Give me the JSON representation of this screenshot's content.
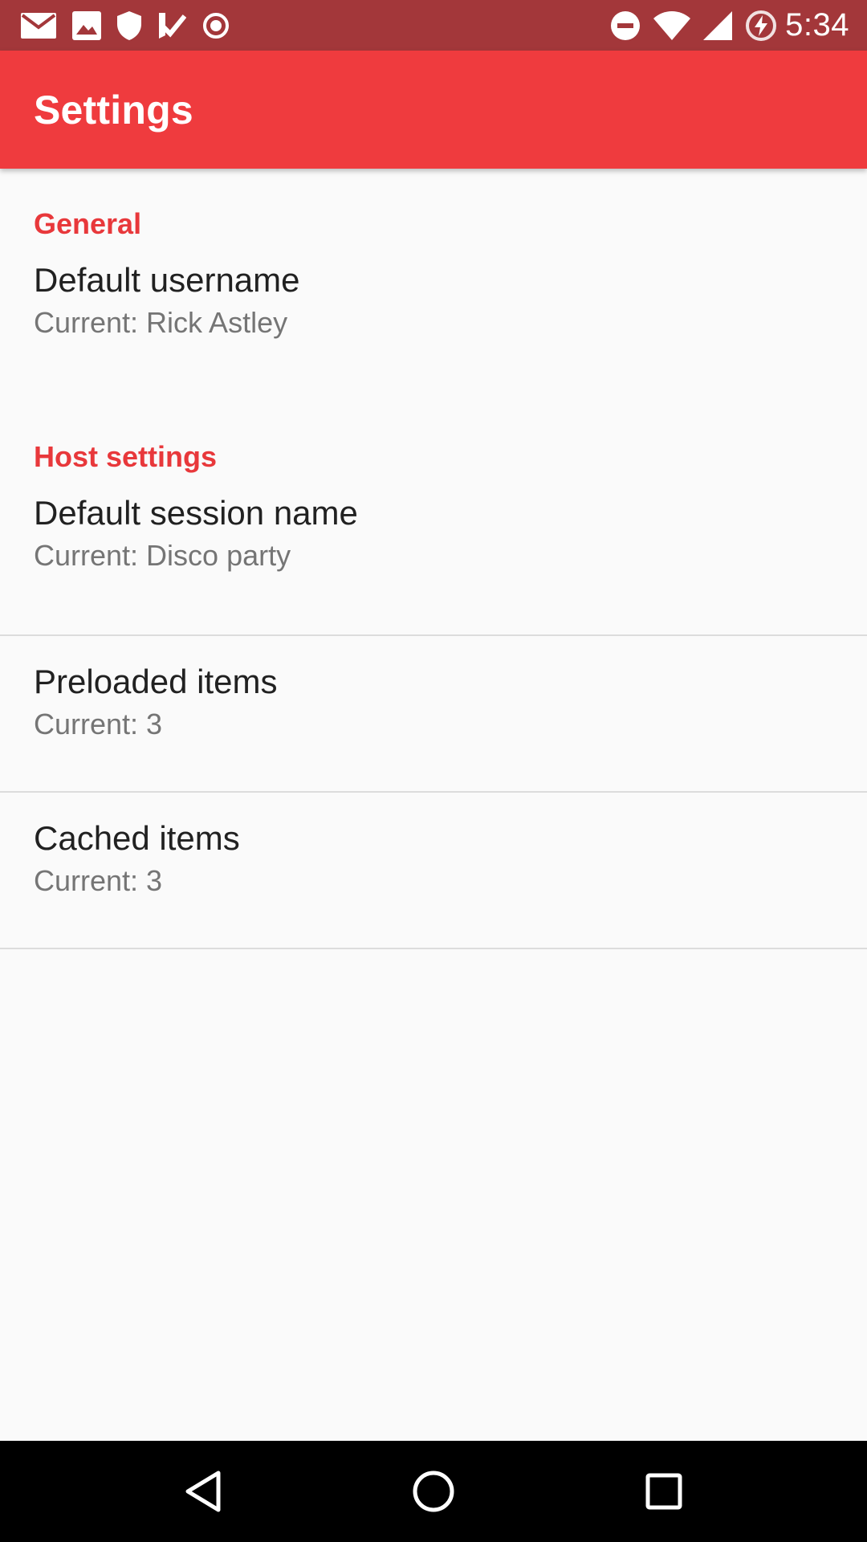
{
  "status_bar": {
    "time": "5:34",
    "left_icons": [
      "gmail-icon",
      "photos-icon",
      "shield-icon",
      "tasks-icon",
      "record-icon"
    ],
    "right_icons": [
      "do-not-disturb-icon",
      "wifi-icon",
      "signal-icon",
      "battery-charging-icon"
    ]
  },
  "app_bar": {
    "title": "Settings"
  },
  "sections": [
    {
      "header": "General",
      "items": [
        {
          "title": "Default username",
          "summary": "Current: Rick Astley"
        }
      ]
    },
    {
      "header": "Host settings",
      "items": [
        {
          "title": "Default session name",
          "summary": "Current: Disco party"
        },
        {
          "title": "Preloaded items",
          "summary": "Current: 3"
        },
        {
          "title": "Cached items",
          "summary": "Current: 3"
        }
      ]
    }
  ],
  "nav_bar": {
    "buttons": [
      "back-icon",
      "home-icon",
      "recents-icon"
    ]
  },
  "colors": {
    "status_bar": "#a3373a",
    "app_bar": "#ef3b3e",
    "accent": "#e8383b",
    "background": "#fafafa"
  }
}
